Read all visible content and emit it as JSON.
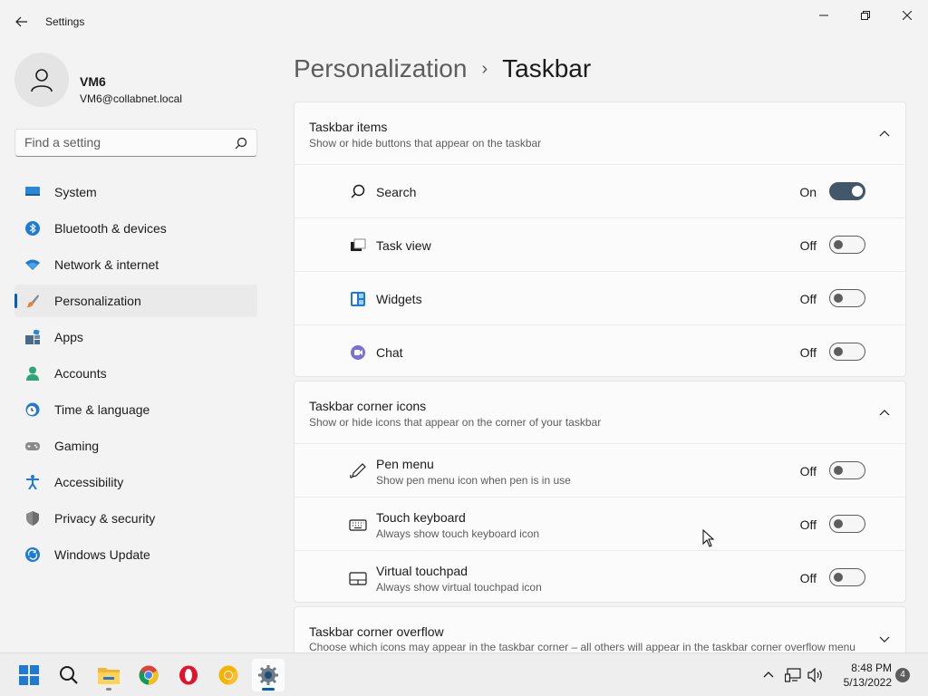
{
  "window": {
    "title": "Settings"
  },
  "user": {
    "name": "VM6",
    "email": "VM6@collabnet.local"
  },
  "search": {
    "placeholder": "Find a setting",
    "value": ""
  },
  "sidebar": {
    "items": [
      {
        "label": "System",
        "icon": "monitor-icon"
      },
      {
        "label": "Bluetooth & devices",
        "icon": "bluetooth-icon"
      },
      {
        "label": "Network & internet",
        "icon": "wifi-icon"
      },
      {
        "label": "Personalization",
        "icon": "brush-icon",
        "active": true
      },
      {
        "label": "Apps",
        "icon": "apps-icon"
      },
      {
        "label": "Accounts",
        "icon": "person-icon"
      },
      {
        "label": "Time & language",
        "icon": "clock-globe-icon"
      },
      {
        "label": "Gaming",
        "icon": "gamepad-icon"
      },
      {
        "label": "Accessibility",
        "icon": "accessibility-icon"
      },
      {
        "label": "Privacy & security",
        "icon": "shield-icon"
      },
      {
        "label": "Windows Update",
        "icon": "update-icon"
      }
    ]
  },
  "breadcrumb": {
    "parent": "Personalization",
    "separator": "›",
    "current": "Taskbar"
  },
  "taskbar_items": {
    "title": "Taskbar items",
    "subtitle": "Show or hide buttons that appear on the taskbar",
    "rows": [
      {
        "label": "Search",
        "state": "On",
        "on": true,
        "icon": "search-icon"
      },
      {
        "label": "Task view",
        "state": "Off",
        "on": false,
        "icon": "task-view-icon"
      },
      {
        "label": "Widgets",
        "state": "Off",
        "on": false,
        "icon": "widgets-icon"
      },
      {
        "label": "Chat",
        "state": "Off",
        "on": false,
        "icon": "chat-icon"
      }
    ]
  },
  "corner_icons": {
    "title": "Taskbar corner icons",
    "subtitle": "Show or hide icons that appear on the corner of your taskbar",
    "rows": [
      {
        "label": "Pen menu",
        "sub": "Show pen menu icon when pen is in use",
        "state": "Off",
        "on": false,
        "icon": "pen-icon"
      },
      {
        "label": "Touch keyboard",
        "sub": "Always show touch keyboard icon",
        "state": "Off",
        "on": false,
        "icon": "keyboard-icon"
      },
      {
        "label": "Virtual touchpad",
        "sub": "Always show virtual touchpad icon",
        "state": "Off",
        "on": false,
        "icon": "touchpad-icon"
      }
    ]
  },
  "corner_overflow": {
    "title": "Taskbar corner overflow",
    "subtitle": "Choose which icons may appear in the taskbar corner – all others will appear in the taskbar corner overflow menu"
  },
  "system_taskbar": {
    "apps": [
      "start-icon",
      "search-icon",
      "file-explorer-icon",
      "chrome-icon",
      "opera-icon",
      "chrome-canary-icon",
      "settings-icon"
    ],
    "time": "8:48 PM",
    "date": "5/13/2022",
    "notification_count": "4"
  },
  "colors": {
    "accent": "#005fb8",
    "toggle_on": "#42586a"
  }
}
